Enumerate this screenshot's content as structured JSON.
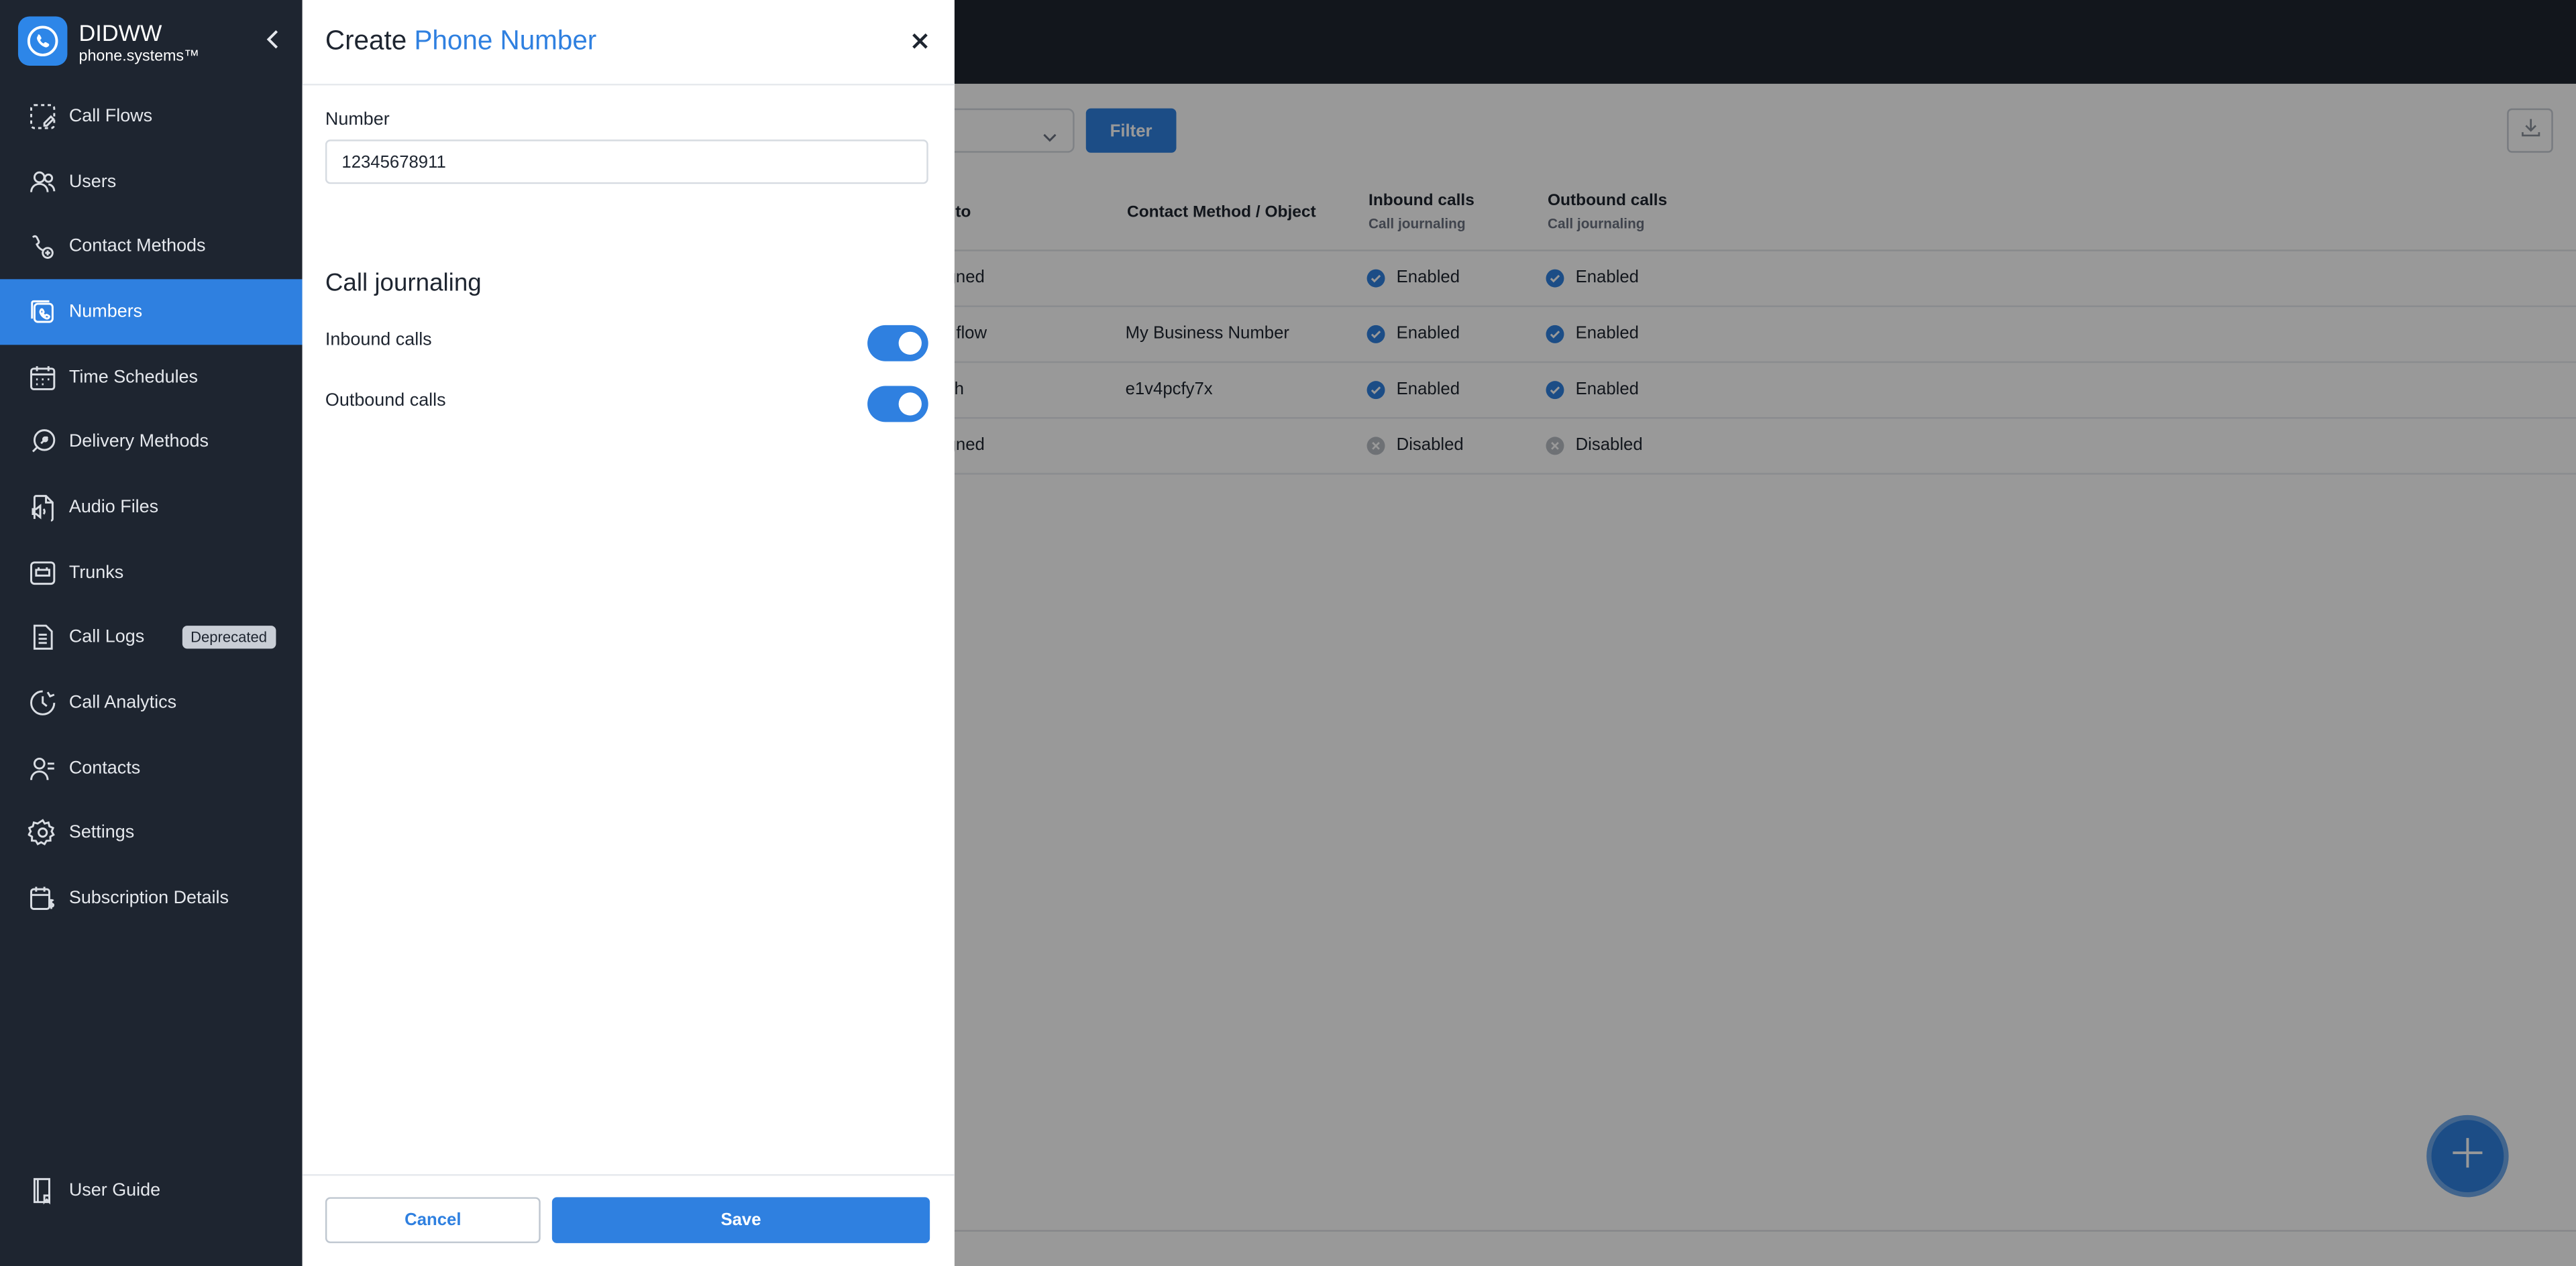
{
  "brand": {
    "name": "DIDWW",
    "sub": "phone.systems™"
  },
  "sidebar": {
    "items": [
      {
        "label": "Call Flows",
        "icon": "call-flows-icon"
      },
      {
        "label": "Users",
        "icon": "users-icon"
      },
      {
        "label": "Contact Methods",
        "icon": "contact-methods-icon"
      },
      {
        "label": "Numbers",
        "icon": "numbers-icon",
        "active": true
      },
      {
        "label": "Time Schedules",
        "icon": "calendar-icon"
      },
      {
        "label": "Delivery Methods",
        "icon": "rocket-icon"
      },
      {
        "label": "Audio Files",
        "icon": "audio-file-icon"
      },
      {
        "label": "Trunks",
        "icon": "trunk-icon"
      },
      {
        "label": "Call Logs",
        "icon": "document-icon",
        "badge": "Deprecated"
      },
      {
        "label": "Call Analytics",
        "icon": "analytics-icon"
      },
      {
        "label": "Contacts",
        "icon": "contacts-icon"
      },
      {
        "label": "Settings",
        "icon": "gear-icon"
      },
      {
        "label": "Subscription Details",
        "icon": "subscription-icon"
      }
    ],
    "guide": {
      "label": "User Guide",
      "icon": "guide-icon"
    }
  },
  "filter": {
    "button": "Filter"
  },
  "table": {
    "headers": {
      "routed_to": "l to",
      "contact": "Contact Method / Object",
      "inbound": "Inbound calls",
      "inbound_sub": "Call journaling",
      "outbound": "Outbound calls",
      "outbound_sub": "Call journaling"
    },
    "rows": [
      {
        "routed": "gned",
        "contact": "",
        "inbound": "Enabled",
        "inbound_on": true,
        "outbound": "Enabled",
        "outbound_on": true
      },
      {
        "routed": "flow",
        "contact": "My Business Number",
        "inbound": "Enabled",
        "inbound_on": true,
        "outbound": "Enabled",
        "outbound_on": true
      },
      {
        "routed": "th",
        "contact": "e1v4pcfy7x",
        "inbound": "Enabled",
        "inbound_on": true,
        "outbound": "Enabled",
        "outbound_on": true
      },
      {
        "routed": "gned",
        "contact": "",
        "inbound": "Disabled",
        "inbound_on": false,
        "outbound": "Disabled",
        "outbound_on": false
      }
    ]
  },
  "modal": {
    "title_prefix": "Create",
    "title_accent": "Phone Number",
    "number_label": "Number",
    "number_value": "12345678911",
    "section_title": "Call journaling",
    "inbound_label": "Inbound calls",
    "inbound_enabled": true,
    "outbound_label": "Outbound calls",
    "outbound_enabled": true,
    "cancel": "Cancel",
    "save": "Save"
  },
  "colors": {
    "accent": "#2f80e0",
    "sidebar": "#1e2530"
  }
}
